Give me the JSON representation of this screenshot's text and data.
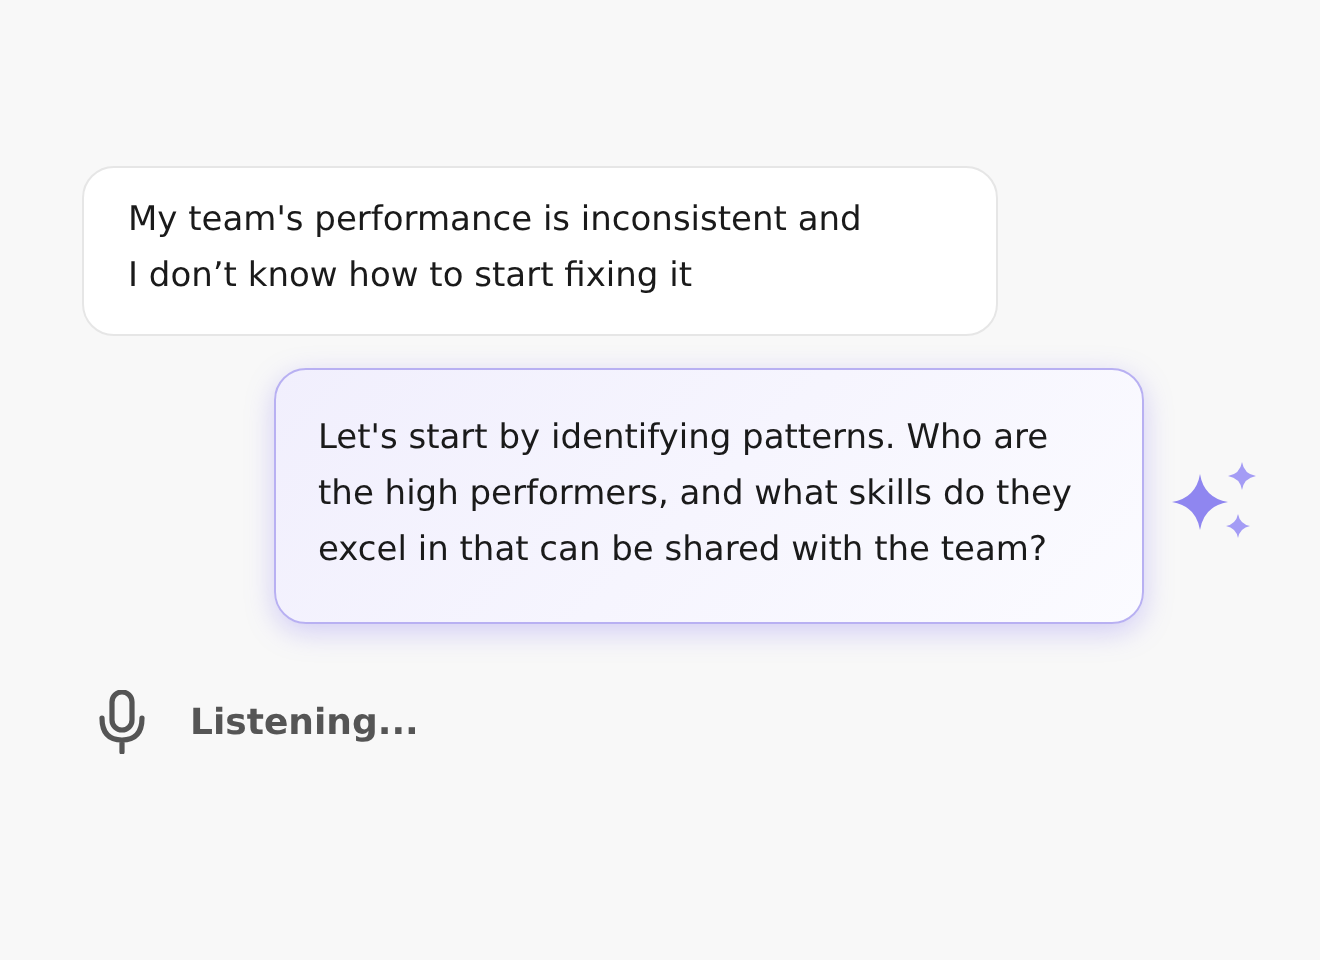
{
  "messages": [
    {
      "kind": "user",
      "text": "My team's performance is inconsistent and I don’t know how to start fixing it"
    },
    {
      "kind": "assistant",
      "text": "Let's start by identifying patterns. Who are the high performers, and what skills do they excel in that can be shared with the team?"
    }
  ],
  "voice_status": {
    "text": "Listening..."
  }
}
